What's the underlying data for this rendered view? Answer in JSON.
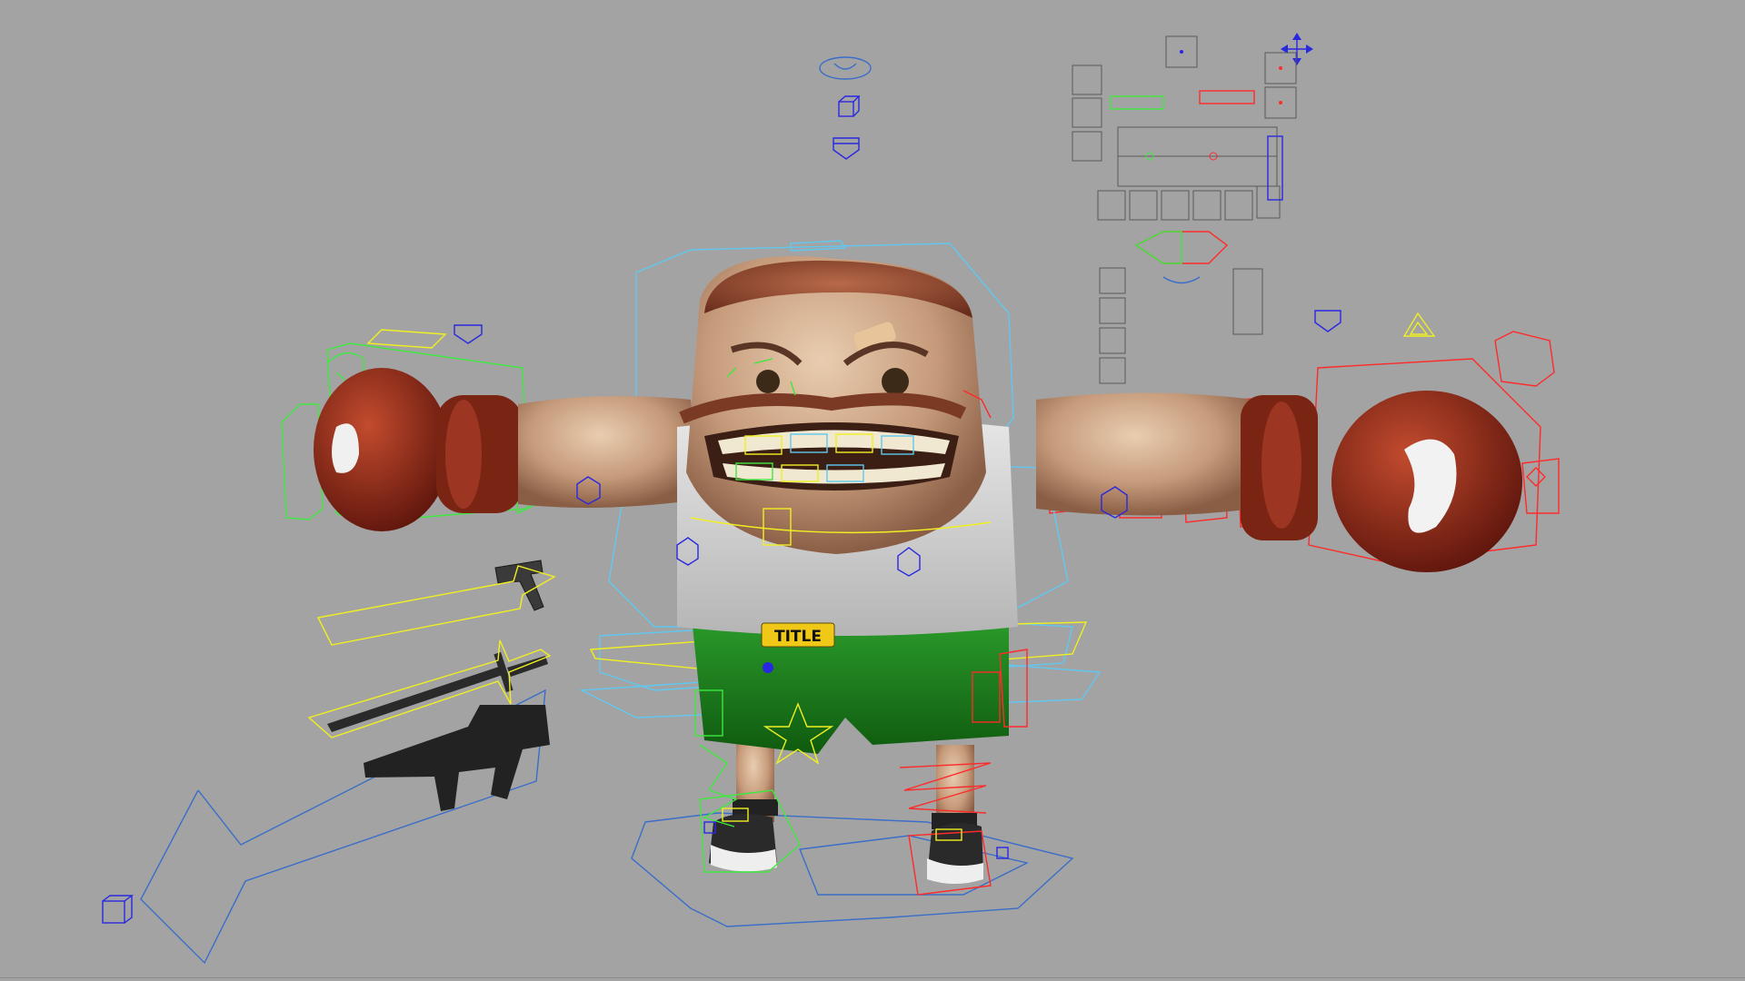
{
  "viewport": {
    "background": "#a3a3a3",
    "badge_text": "TITLE",
    "colors": {
      "left_controls": "#3ee83e",
      "right_controls": "#ff2a2a",
      "center_controls": "#60c8f0",
      "yellow_controls": "#f0f020",
      "blue_icons": "#2828e0",
      "world_control": "#3a6ec8"
    },
    "icons": [
      "eye-icon",
      "cube-icon",
      "move-arrows-icon",
      "shield-icon",
      "triangle-icon"
    ],
    "props": [
      "pistol",
      "sword",
      "assault-rifle"
    ]
  }
}
